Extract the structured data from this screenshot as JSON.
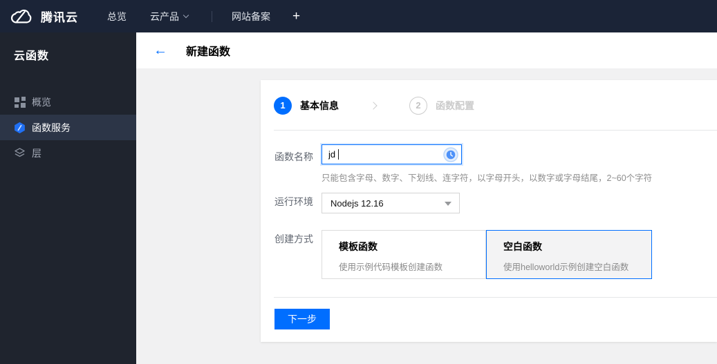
{
  "colors": {
    "accent": "#006eff",
    "topbar_bg": "#1b2437",
    "sidebar_bg": "#1f242e",
    "sidebar_selected_bg": "#2c3547",
    "content_bg": "#f1f1f2"
  },
  "topbar": {
    "brand": "腾讯云",
    "nav": [
      {
        "label": "总览"
      },
      {
        "label": "云产品",
        "has_caret": true
      },
      {
        "label": "网站备案"
      }
    ],
    "add_tab": "+"
  },
  "sidebar": {
    "title": "云函数",
    "items": [
      {
        "label": "概览",
        "icon": "grid-icon",
        "selected": false
      },
      {
        "label": "函数服务",
        "icon": "function-hexagon-icon",
        "selected": true
      },
      {
        "label": "层",
        "icon": "layers-icon",
        "selected": false
      }
    ]
  },
  "header": {
    "back_icon": "←",
    "title": "新建函数"
  },
  "wizard": {
    "steps": [
      {
        "num": "1",
        "label": "基本信息",
        "active": true
      },
      {
        "num": "2",
        "label": "函数配置",
        "active": false
      }
    ]
  },
  "form": {
    "name": {
      "label": "函数名称",
      "value": "jd",
      "help": "只能包含字母、数字、下划线、连字符，以字母开头，以数字或字母结尾，2~60个字符",
      "trailing_icon": "clock-history-icon"
    },
    "runtime": {
      "label": "运行环境",
      "value": "Nodejs 12.16"
    },
    "method": {
      "label": "创建方式",
      "options": [
        {
          "title": "模板函数",
          "desc": "使用示例代码模板创建函数",
          "selected": false
        },
        {
          "title": "空白函数",
          "desc": "使用helloworld示例创建空白函数",
          "selected": true
        }
      ]
    },
    "next_label": "下一步"
  }
}
